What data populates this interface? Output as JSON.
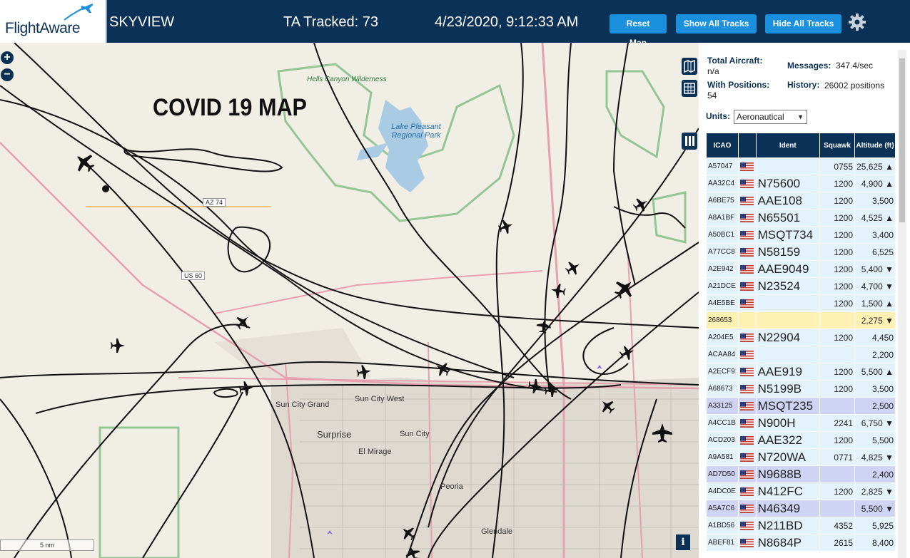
{
  "header": {
    "logo_text": "FlightAware",
    "app_title": "SKYVIEW",
    "ta_tracked": "TA Tracked: 73",
    "datetime": "4/23/2020, 9:12:33 AM",
    "buttons": {
      "reset_map": "Reset Map",
      "show_all_tracks": "Show All Tracks",
      "hide_all_tracks": "Hide All Tracks"
    }
  },
  "map": {
    "overlay_title": "COVID 19 MAP",
    "scale_label": "5 nm",
    "labels": {
      "hells_canyon": "Hells Canyon Wilderness",
      "lake_pleasant": "Lake Pleasant Regional Park",
      "sun_city_grand": "Sun City Grand",
      "sun_city_west": "Sun City West",
      "surprise": "Surprise",
      "sun_city": "Sun City",
      "el_mirage": "El Mirage",
      "peoria": "Peoria",
      "glendale": "Glendale",
      "az74": "AZ 74",
      "us60": "US 60"
    },
    "colors": {
      "track": "#111111",
      "road": "#e8a0b0",
      "water": "#a9cbe4",
      "park": "#94c595",
      "urban": "#d9d5cc"
    }
  },
  "panel": {
    "total_aircraft_label": "Total Aircraft:",
    "total_aircraft_value": "n/a",
    "messages_label": "Messages:",
    "messages_value": "347.4/sec",
    "with_positions_label": "With Positions:",
    "with_positions_value": "54",
    "history_label": "History:",
    "history_value": "26002 positions",
    "units_label": "Units:",
    "units_value": "Aeronautical",
    "columns": [
      "ICAO",
      "",
      "Ident",
      "Squawk",
      "Altitude (ft)"
    ],
    "rows": [
      {
        "icao": "A57047",
        "ident": "",
        "squawk": "0755",
        "alt": "25,625 ▲",
        "state": ""
      },
      {
        "icao": "AA32C4",
        "ident": "N75600",
        "squawk": "1200",
        "alt": "4,900 ▲",
        "state": ""
      },
      {
        "icao": "A6BE75",
        "ident": "AAE108",
        "squawk": "1200",
        "alt": "3,500",
        "state": ""
      },
      {
        "icao": "A8A1BF",
        "ident": "N65501",
        "squawk": "1200",
        "alt": "4,525 ▲",
        "state": ""
      },
      {
        "icao": "A50BC1",
        "ident": "MSQT734",
        "squawk": "1200",
        "alt": "3,400",
        "state": ""
      },
      {
        "icao": "A77CC8",
        "ident": "N58159",
        "squawk": "1200",
        "alt": "6,525",
        "state": ""
      },
      {
        "icao": "A2E942",
        "ident": "AAE9049",
        "squawk": "1200",
        "alt": "5,400 ▼",
        "state": ""
      },
      {
        "icao": "A21DCE",
        "ident": "N23524",
        "squawk": "1200",
        "alt": "4,700 ▼",
        "state": ""
      },
      {
        "icao": "A4E5BE",
        "ident": "",
        "squawk": "1200",
        "alt": "1,500 ▲",
        "state": ""
      },
      {
        "icao": "268653",
        "ident": "",
        "squawk": "",
        "alt": "2,275 ▼",
        "state": "hl"
      },
      {
        "icao": "A204E5",
        "ident": "N22904",
        "squawk": "1200",
        "alt": "4,450",
        "state": ""
      },
      {
        "icao": "ACAA84",
        "ident": "",
        "squawk": "",
        "alt": "2,200",
        "state": ""
      },
      {
        "icao": "A2ECF9",
        "ident": "AAE919",
        "squawk": "1200",
        "alt": "5,500 ▲",
        "state": ""
      },
      {
        "icao": "A68673",
        "ident": "N5199B",
        "squawk": "1200",
        "alt": "3,500",
        "state": ""
      },
      {
        "icao": "A33125",
        "ident": "MSQT235",
        "squawk": "",
        "alt": "2,500",
        "state": "sel"
      },
      {
        "icao": "A4CC1B",
        "ident": "N900H",
        "squawk": "2241",
        "alt": "6,750 ▼",
        "state": ""
      },
      {
        "icao": "ACD203",
        "ident": "AAE322",
        "squawk": "1200",
        "alt": "5,500",
        "state": ""
      },
      {
        "icao": "A9A581",
        "ident": "N720WA",
        "squawk": "0771",
        "alt": "4,825 ▼",
        "state": ""
      },
      {
        "icao": "AD7D50",
        "ident": "N9688B",
        "squawk": "",
        "alt": "2,400",
        "state": "sel"
      },
      {
        "icao": "A4DC0E",
        "ident": "N412FC",
        "squawk": "1200",
        "alt": "2,825 ▼",
        "state": ""
      },
      {
        "icao": "A5A7C6",
        "ident": "N46349",
        "squawk": "",
        "alt": "5,500 ▼",
        "state": "sel"
      },
      {
        "icao": "A1BD56",
        "ident": "N211BD",
        "squawk": "4352",
        "alt": "5,925",
        "state": ""
      },
      {
        "icao": "ABEF81",
        "ident": "N8684P",
        "squawk": "2615",
        "alt": "8,400",
        "state": ""
      }
    ]
  }
}
